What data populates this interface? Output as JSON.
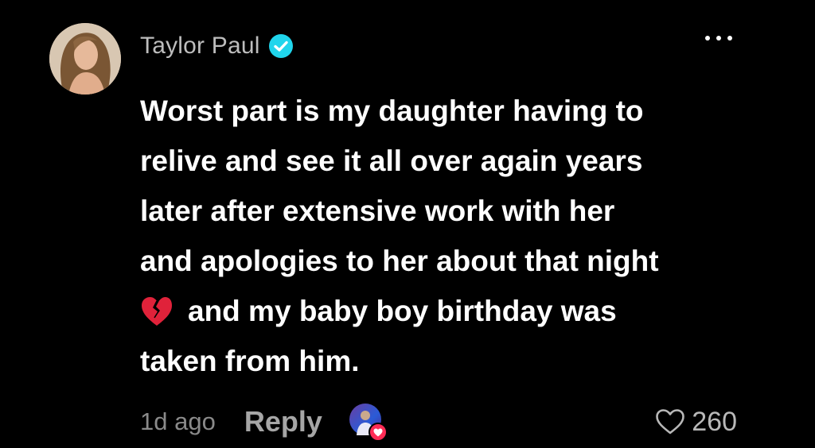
{
  "comment": {
    "username": "Taylor Paul",
    "verified_icon": "verified-badge-icon",
    "verified_color": "#20d5ec",
    "more_icon": "more-options-icon",
    "body_lines": [
      "Worst part is my daughter having to",
      "relive and see it all over again years",
      "later after extensive work with her",
      "and apologies to her about that night",
      "and my baby boy birthday was",
      "taken from him."
    ],
    "emoji": "broken-heart-icon",
    "timestamp": "1d ago",
    "reply_label": "Reply",
    "creator_liked_icon": "creator-liked-avatar-icon",
    "like_icon": "heart-outline-icon",
    "like_count": "260"
  }
}
